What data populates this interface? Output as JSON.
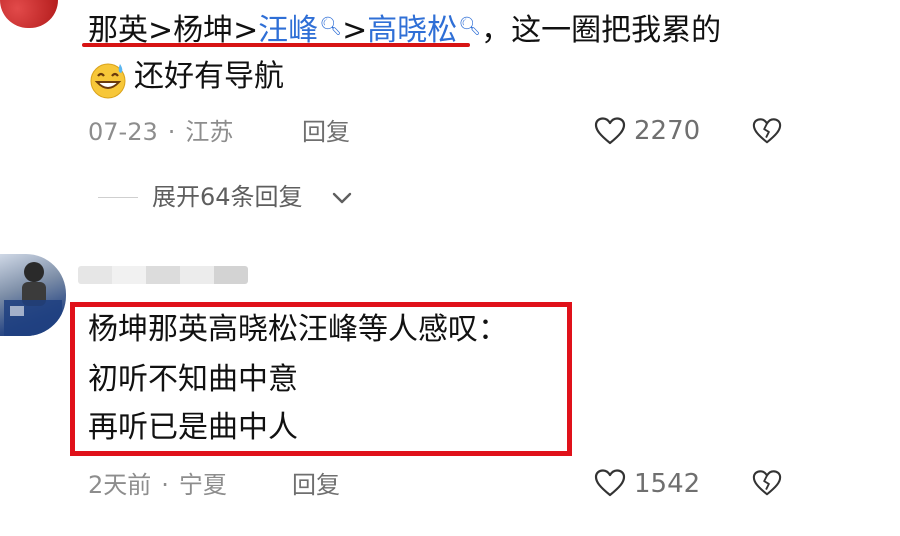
{
  "comment1": {
    "names": {
      "name1": "那英",
      "sep1": ">",
      "name2": "杨坤",
      "sep2": ">",
      "link1": "汪峰",
      "sep3": ">",
      "link2": "高晓松"
    },
    "text_rest": "，这一圈把我累的",
    "line2": "还好有导航",
    "emoji_icon": "grinning-sweat-emoji",
    "date": "07-23",
    "dot": "·",
    "location": "江苏",
    "reply_label": "回复",
    "likes": "2270",
    "expand_label": "展开64条回复"
  },
  "comment2": {
    "lines": [
      "杨坤那英高晓松汪峰等人感叹：",
      "初听不知曲中意",
      "再听已是曲中人"
    ],
    "time": "2天前",
    "dot": "·",
    "location": "宁夏",
    "reply_label": "回复",
    "likes": "1542"
  },
  "colors": {
    "link": "#2f6fd6",
    "highlight_red": "#e0111a",
    "meta_gray": "#8d8d8d"
  }
}
